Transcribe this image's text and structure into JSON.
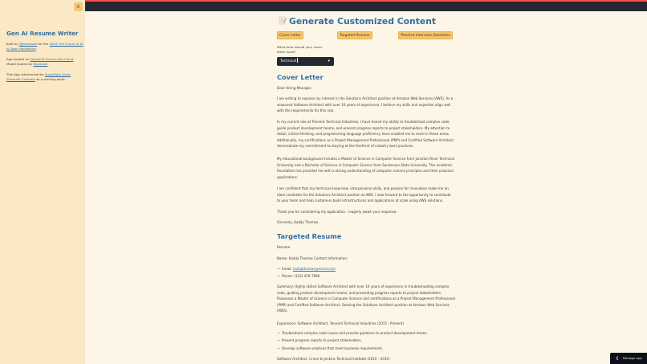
{
  "sidebar": {
    "collapse_icon": "x",
    "title": "Gen AI Resume Writer",
    "built_by_prefix": "Built by ",
    "built_by_link": "@Jessicade",
    "built_for_text": " for the ",
    "built_for_link": "2024 The Future of AI is Open Hackathon",
    "built_for_suffix": ".",
    "hosted_prefix": "App hosted on ",
    "hosted_link": "Streamlit Community Cloud",
    "hosted_suffix": ".",
    "model_prefix": "Model hosted by ",
    "model_link": "Replicate",
    "model_suffix": ".",
    "ref_prefix": "This App referenced the ",
    "ref_link": "Snowflake Arctic Streamlit Example",
    "ref_suffix": " as a starting point."
  },
  "main": {
    "title": "Generate Customized Content",
    "tabs": [
      "Cover Letter",
      "Targeted Resume",
      "Practice Interview Questions"
    ],
    "tone_label": "What tone should your cover letter have?",
    "tone_value": "Technical",
    "cover_letter": {
      "heading": "Cover Letter",
      "greeting": "Dear Hiring Manager,",
      "paragraphs": [
        "I am writing to express my interest in the Solutions Architect position at Amazon Web Services (AWS). As a seasoned Software Architect with over 10 years of experience, I believe my skills and expertise align well with the requirements for this role.",
        "In my current role at Tennent Technical Industries, I have honed my ability to troubleshoot complex code, guide product development teams, and present progress reports to project stakeholders. My attention to detail, critical thinking, and programming language proficiency have enabled me to excel in these areas. Additionally, my certifications as a Project Management Professional (PMP) and Certified Software Architect demonstrate my commitment to staying at the forefront of industry best practices.",
        "My educational background includes a Master of Science in Computer Science from Junction River Technical University and a Bachelor of Science in Computer Science from Sanderson State University. This academic foundation has provided me with a strong understanding of computer science principles and their practical applications.",
        "I am confident that my technical know-how, interpersonal skills, and passion for innovation make me an ideal candidate for the Solutions Architect position at AWS. I look forward to the opportunity to contribute to your team and help customers build infrastructures and applications at scale using AWS solutions.",
        "Thank you for considering my application. I eagerly await your response."
      ],
      "signoff": "Sincerely, Kadija Thomas"
    },
    "targeted_resume": {
      "heading": "Targeted Resume",
      "label": "Resume",
      "name_line": "Name: Kadija Thomas Contact Information:",
      "email_prefix": "Email: ",
      "email": "kadijathomas@email.com",
      "phone": "Phone: (123) 456-7890",
      "summary": "Summary: Highly skilled Software Architect with over 10 years of experience in troubleshooting complex code, guiding product development teams, and presenting progress reports to project stakeholders. Possesses a Master of Science in Computer Science and certifications as a Project Management Professional (PMP) and Certified Software Architect. Seeking the Solutions Architect position at Amazon Web Services (AWS).",
      "experience_line": "Experience: Software Architect, Tennent Technical Industries (2015 - Present)",
      "bullets": [
        "Troubleshoot complex code issues and provide guidance to product development teams.",
        "Present progress reports to project stakeholders.",
        "Develop software solutions that meet business requirements."
      ],
      "next_job": "Software Architect, Crane & Jenkins Technical Institute (2010 - 2015)"
    }
  },
  "footer": {
    "manage_app": "Manage app"
  },
  "colors": {
    "sidebar_bg": "#fbe8c4",
    "main_bg": "#fdf6e6",
    "accent_blue": "#2f6ea8",
    "button_bg": "#f5c66b",
    "select_bg": "#262730",
    "topbar_bg": "#262730"
  }
}
